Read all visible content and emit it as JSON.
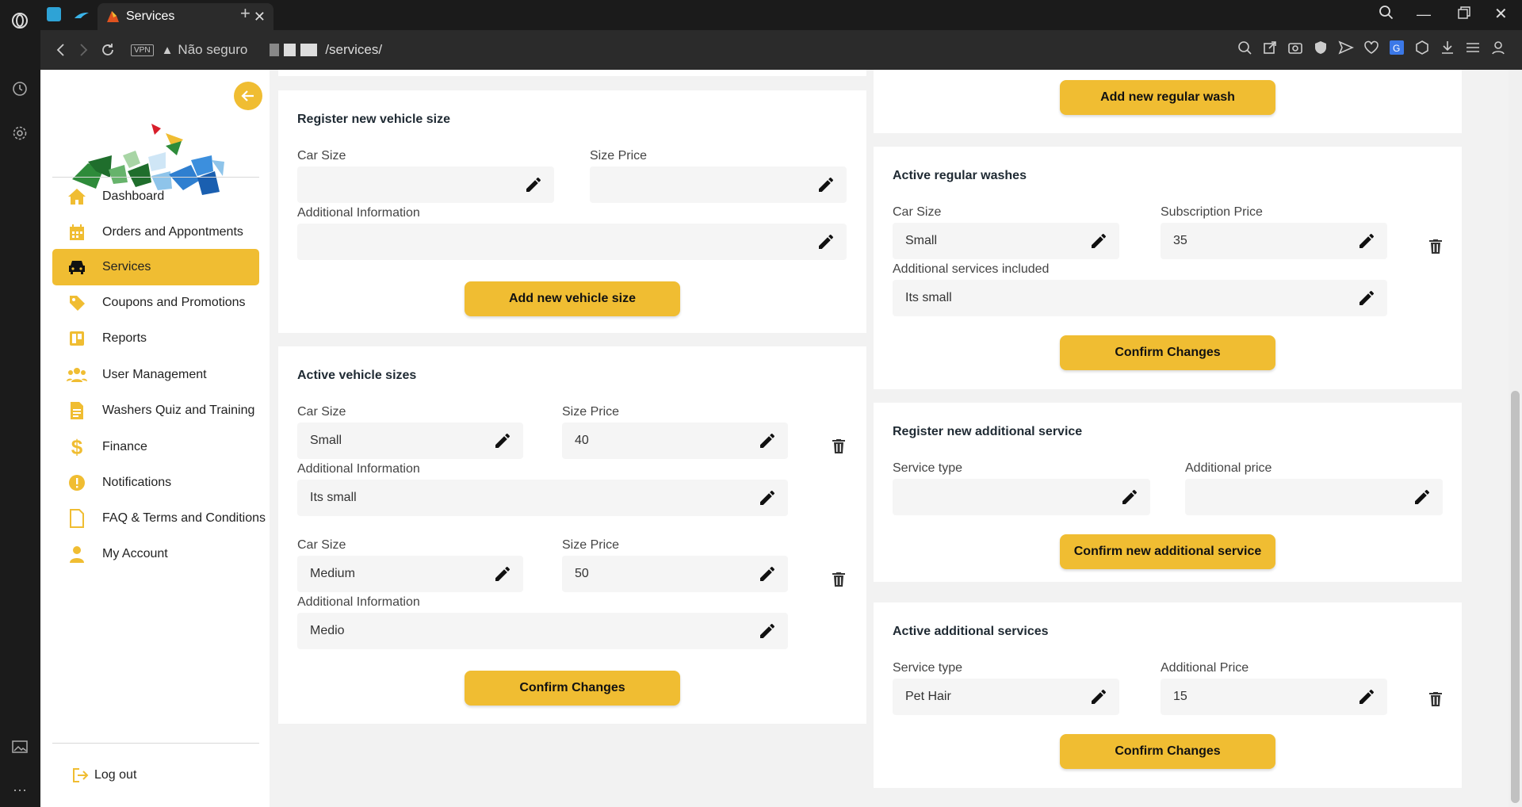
{
  "browser": {
    "tab_title": "Services",
    "new_tab": "+",
    "vpn": "VPN",
    "security": "Não seguro",
    "url": "/services/"
  },
  "sidebar": {
    "items": [
      {
        "label": "Dashboard",
        "icon": "home-icon"
      },
      {
        "label": "Orders and Appontments",
        "icon": "calendar-icon"
      },
      {
        "label": "Services",
        "icon": "car-icon",
        "active": true
      },
      {
        "label": "Coupons and Promotions",
        "icon": "tag-icon"
      },
      {
        "label": "Reports",
        "icon": "board-icon"
      },
      {
        "label": "User Management",
        "icon": "users-icon"
      },
      {
        "label": "Washers Quiz and Training",
        "icon": "document-icon"
      },
      {
        "label": "Finance",
        "icon": "dollar-icon"
      },
      {
        "label": "Notifications",
        "icon": "alert-icon"
      },
      {
        "label": "FAQ & Terms and Conditions",
        "icon": "file-icon"
      },
      {
        "label": "My Account",
        "icon": "user-icon"
      }
    ],
    "logout": "Log out"
  },
  "register_size": {
    "title": "Register new vehicle size",
    "car_size_label": "Car Size",
    "size_price_label": "Size Price",
    "info_label": "Additional Information",
    "car_size": "",
    "size_price": "",
    "info": "",
    "button": "Add new vehicle size"
  },
  "active_sizes": {
    "title": "Active vehicle sizes",
    "car_size_label": "Car Size",
    "size_price_label": "Size Price",
    "info_label": "Additional Information",
    "items": [
      {
        "car_size": "Small",
        "price": "40",
        "info": "Its small"
      },
      {
        "car_size": "Medium",
        "price": "50",
        "info": "Medio"
      }
    ],
    "button": "Confirm Changes"
  },
  "regular_wash": {
    "add_button": "Add new regular wash"
  },
  "active_washes": {
    "title": "Active regular washes",
    "car_size_label": "Car Size",
    "price_label": "Subscription Price",
    "services_label": "Additional services included",
    "car_size": "Small",
    "price": "35",
    "services": "Its small",
    "button": "Confirm Changes"
  },
  "register_additional": {
    "title": "Register new additional service",
    "type_label": "Service type",
    "price_label": "Additional price",
    "type": "",
    "price": "",
    "button": "Confirm new additional service"
  },
  "active_additional": {
    "title": "Active additional services",
    "type_label": "Service type",
    "price_label": "Additional Price",
    "type": "Pet Hair",
    "price": "15",
    "button": "Confirm Changes"
  },
  "colors": {
    "accent": "#f0bd32",
    "brand_green": "#2e8b3a",
    "brand_blue": "#2f7fd0"
  }
}
